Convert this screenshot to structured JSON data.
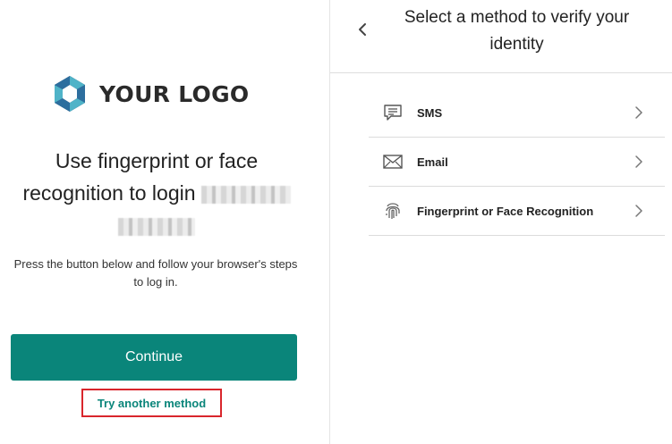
{
  "left": {
    "logo_text": "YOUR LOGO",
    "headline": "Use fingerprint or face recognition to login",
    "subtext": "Press the button below and follow your browser's steps to log in.",
    "continue_label": "Continue",
    "try_another_label": "Try another method"
  },
  "right": {
    "header_title": "Select a method to verify your identity",
    "methods": [
      {
        "label": "SMS",
        "icon": "sms-icon"
      },
      {
        "label": "Email",
        "icon": "email-icon"
      },
      {
        "label": "Fingerprint or Face Recognition",
        "icon": "fingerprint-icon"
      }
    ]
  },
  "colors": {
    "accent": "#0a857a",
    "highlight_border": "#d9262c",
    "logo_dark": "#1e3a5f",
    "logo_light": "#4fb3c8"
  }
}
